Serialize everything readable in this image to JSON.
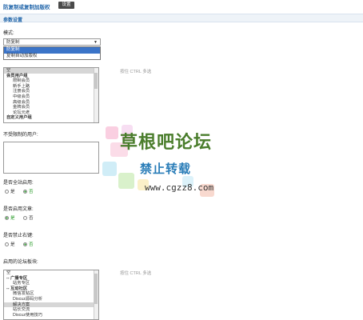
{
  "header": {
    "title": "防复制或复制加版权",
    "settings_button": "设置"
  },
  "section": {
    "title": "参数设置"
  },
  "mode": {
    "label": "模式:",
    "selected": "防复制",
    "options": [
      "防复制",
      "复制自动加版权"
    ]
  },
  "groups": {
    "hint": "按住 CTRL 多选",
    "items": [
      {
        "label": "空",
        "type": "plain",
        "selected": true
      },
      {
        "label": "会员用户组",
        "type": "group"
      },
      {
        "label": "限制会员",
        "type": "indent"
      },
      {
        "label": "新手上路",
        "type": "indent"
      },
      {
        "label": "注册会员",
        "type": "indent"
      },
      {
        "label": "中级会员",
        "type": "indent"
      },
      {
        "label": "高级会员",
        "type": "indent"
      },
      {
        "label": "金牌会员",
        "type": "indent"
      },
      {
        "label": "论坛元老",
        "type": "indent"
      },
      {
        "label": "自定义用户组",
        "type": "group"
      }
    ]
  },
  "users": {
    "label": "不受限制的用户:"
  },
  "full_site": {
    "label": "是否全站启用:",
    "options": [
      "是",
      "否"
    ],
    "selected": "否"
  },
  "articles": {
    "label": "是否启用文章:",
    "options": [
      "是",
      "否"
    ],
    "selected": "是"
  },
  "right_click": {
    "label": "是否禁止右键:",
    "options": [
      "是",
      "否"
    ],
    "selected": "否"
  },
  "forums": {
    "label": "启用的论坛板块:",
    "hint": "按住 CTRL 多选",
    "items": [
      {
        "label": "空",
        "type": "plain"
      },
      {
        "label": "-- 广播专区",
        "type": "group"
      },
      {
        "label": "站务专区",
        "type": "indent"
      },
      {
        "label": "-- 互动社区",
        "type": "group"
      },
      {
        "label": "微信发帖区",
        "type": "indent"
      },
      {
        "label": "Discuz源码分析",
        "type": "indent"
      },
      {
        "label": "解决方案",
        "type": "indent",
        "selected": true
      },
      {
        "label": "站长交流",
        "type": "indent"
      },
      {
        "label": "Discuz使用技巧",
        "type": "indent"
      }
    ]
  },
  "watermark": {
    "title": "草根吧论坛",
    "subtitle": "禁止转载",
    "url": "www.cgzz8.com"
  },
  "colors": {
    "accent": "#2266aa",
    "selection": "#3b74c8",
    "radio_on": "#229922",
    "section_bg": "#eef3f8"
  }
}
